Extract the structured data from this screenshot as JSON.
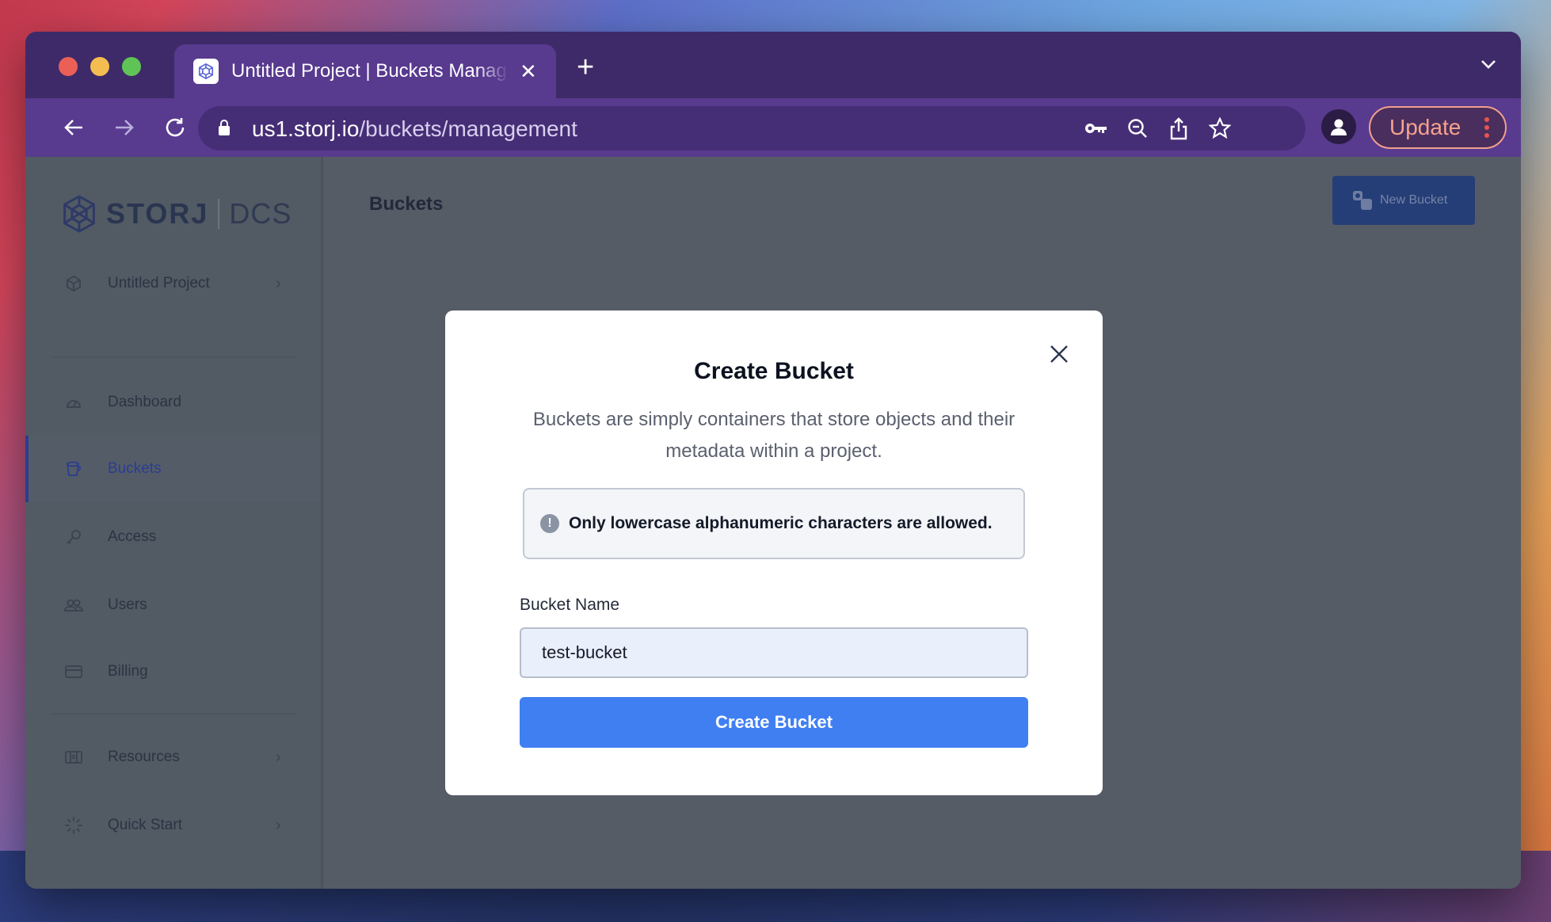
{
  "browser": {
    "tab_title": "Untitled Project | Buckets Management",
    "url_host": "us1.storj.io",
    "url_path": "/buckets/management",
    "update_label": "Update"
  },
  "sidebar": {
    "brand_name": "STORJ",
    "brand_sub": "DCS",
    "project": {
      "label": "Untitled Project",
      "icon": "cube-icon"
    },
    "items": [
      {
        "label": "Dashboard",
        "icon": "dashboard-icon"
      },
      {
        "label": "Buckets",
        "icon": "bucket-icon",
        "active": true
      },
      {
        "label": "Access",
        "icon": "key-icon"
      },
      {
        "label": "Users",
        "icon": "users-icon"
      },
      {
        "label": "Billing",
        "icon": "card-icon"
      }
    ],
    "footer_items": [
      {
        "label": "Resources",
        "icon": "resources-icon"
      },
      {
        "label": "Quick Start",
        "icon": "quickstart-icon"
      }
    ]
  },
  "main": {
    "page_title": "Buckets",
    "new_bucket_label": "New Bucket"
  },
  "modal": {
    "title": "Create Bucket",
    "description": "Buckets are simply containers that store objects and their metadata within a project.",
    "alert_text": "Only lowercase alphanumeric characters are allowed.",
    "field_label": "Bucket Name",
    "field_value": "test-bucket",
    "submit_label": "Create Bucket"
  },
  "colors": {
    "browser_frame": "#583a8f",
    "primary_button": "#3f7ff2",
    "overlay": "#555c66"
  }
}
